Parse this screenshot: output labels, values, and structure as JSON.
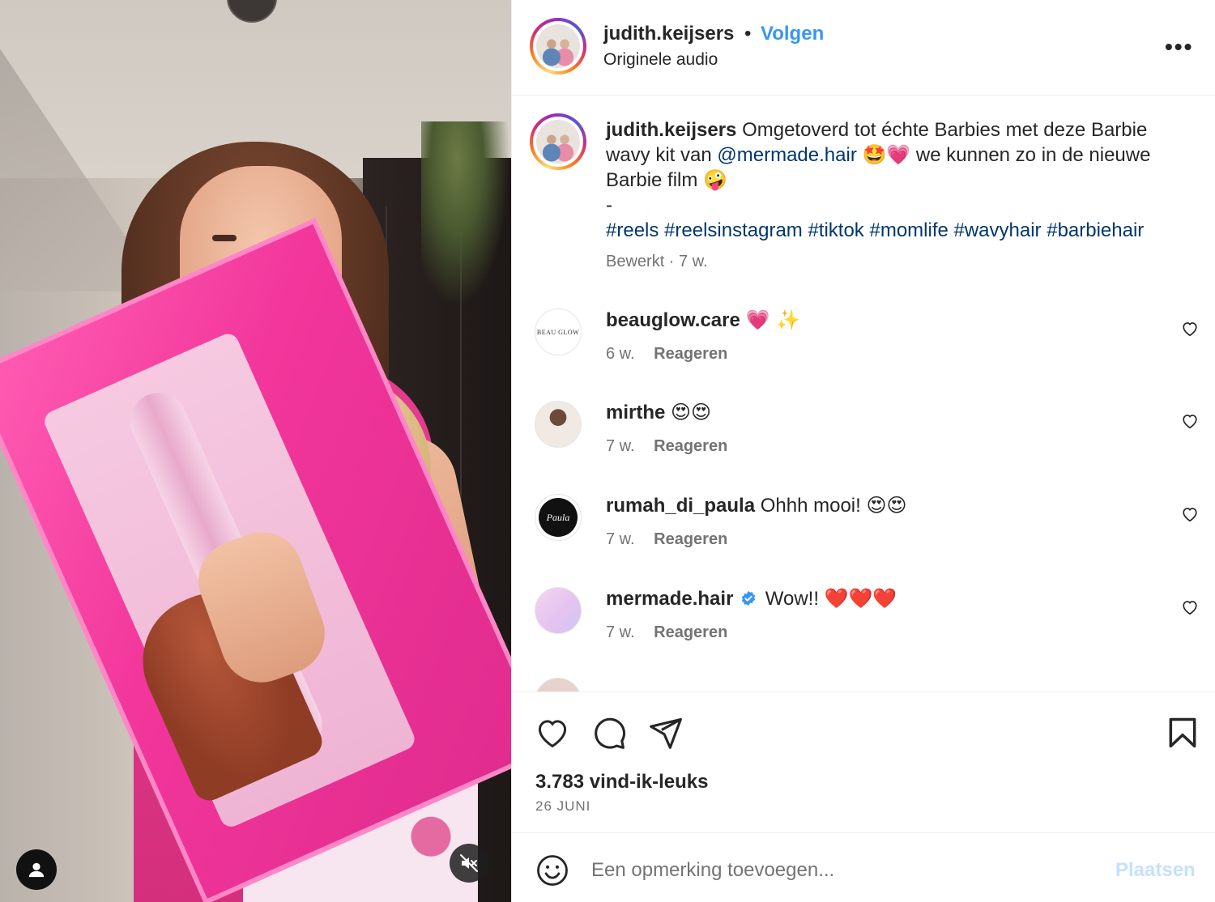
{
  "header": {
    "username": "judith.keijsers",
    "separator": "•",
    "follow_label": "Volgen",
    "audio_label": "Originele audio",
    "more_label": "•••"
  },
  "caption": {
    "username": "judith.keijsers",
    "text_1": "Omgetoverd tot échte Barbies met deze Barbie wavy kit van",
    "mention": "@mermade.hair",
    "emoji_1": "🤩💗",
    "text_2": "we kunnen zo in de nieuwe Barbie film",
    "emoji_2": "🤪",
    "dash": "-",
    "hashtags": "#reels #reelsinstagram #tiktok #momlife #wavyhair #barbiehair",
    "meta": "Bewerkt · 7 w."
  },
  "comments": [
    {
      "username": "beauglow.care",
      "text": "",
      "emoji": "💗 ✨",
      "time": "6 w.",
      "reply": "Reageren",
      "avatar_text": "BEAU GLOW",
      "verified": false
    },
    {
      "username": "mirthe",
      "text": "",
      "emoji": "😍😍",
      "time": "7 w.",
      "reply": "Reageren",
      "avatar_text": "",
      "verified": false
    },
    {
      "username": "rumah_di_paula",
      "text": "Ohhh mooi!",
      "emoji": "😍😍",
      "time": "7 w.",
      "reply": "Reageren",
      "avatar_text": "Paula",
      "verified": false
    },
    {
      "username": "mermade.hair",
      "text": "Wow!!",
      "emoji": "❤️❤️❤️",
      "time": "7 w.",
      "reply": "Reageren",
      "avatar_text": "",
      "verified": true
    }
  ],
  "footer": {
    "likes": "3.783 vind-ik-leuks",
    "date": "26 JUNI"
  },
  "add_comment": {
    "placeholder": "Een opmerking toevoegen...",
    "post_label": "Plaatsen"
  },
  "colors": {
    "follow_blue": "#3897f0",
    "link_blue": "#00376b",
    "secondary_text": "#737373",
    "post_disabled": "#c5e1fb",
    "verified_blue": "#3897f0"
  },
  "icons": [
    "user-icon",
    "muted-speaker-icon",
    "more-icon",
    "heart-icon",
    "comment-icon",
    "share-icon",
    "bookmark-icon",
    "smiley-icon",
    "verified-icon"
  ]
}
